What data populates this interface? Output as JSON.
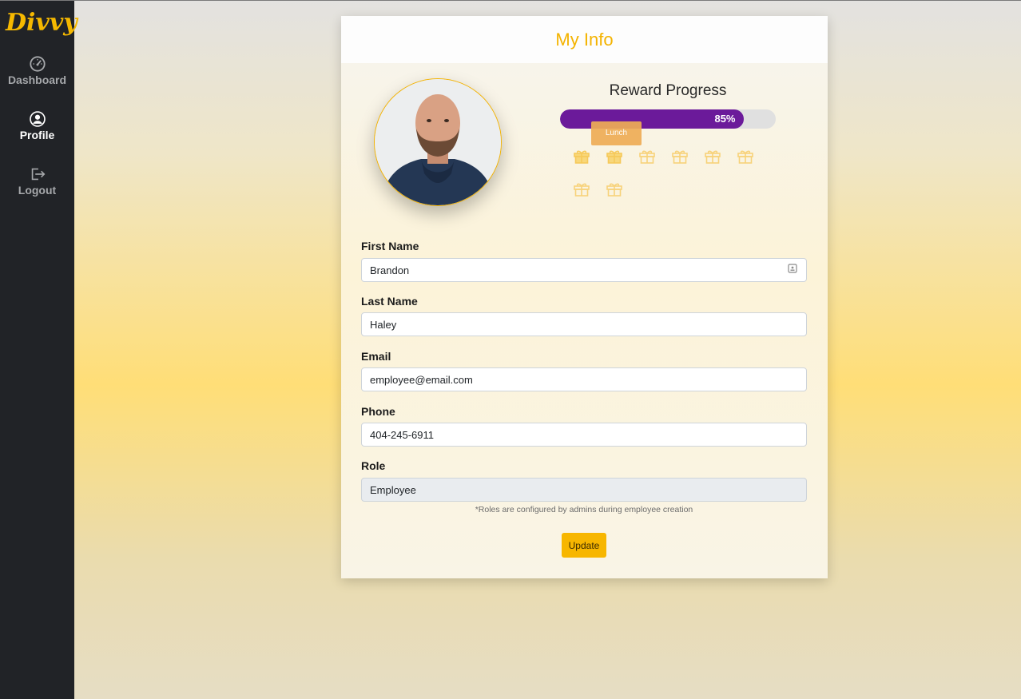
{
  "app": {
    "logo_text": "Divvy",
    "brand_color": "#f4b300"
  },
  "sidebar": {
    "items": [
      {
        "label": "Dashboard",
        "icon": "dashboard-gauge-icon",
        "active": false
      },
      {
        "label": "Profile",
        "icon": "user-circle-icon",
        "active": true
      },
      {
        "label": "Logout",
        "icon": "logout-icon",
        "active": false
      }
    ]
  },
  "card": {
    "title": "My Info",
    "avatar": {
      "icon": "avatar-photo"
    },
    "reward": {
      "title": "Reward Progress",
      "progress": 0.85,
      "progress_label": "85%",
      "progress_color": "#6b1a9a",
      "tooltip": "Lunch",
      "gifts": [
        {
          "name": "gift-icon",
          "earned": true
        },
        {
          "name": "gift-icon",
          "earned": true
        },
        {
          "name": "gift-icon",
          "earned": false
        },
        {
          "name": "gift-icon",
          "earned": false
        },
        {
          "name": "gift-icon",
          "earned": false
        },
        {
          "name": "gift-icon",
          "earned": false
        },
        {
          "name": "gift-icon",
          "earned": false
        },
        {
          "name": "gift-icon",
          "earned": false
        }
      ]
    },
    "form": {
      "first_name": {
        "label": "First Name",
        "value": "Brandon"
      },
      "last_name": {
        "label": "Last Name",
        "value": "Haley"
      },
      "email": {
        "label": "Email",
        "value": "employee@email.com"
      },
      "phone": {
        "label": "Phone",
        "value": "404-245-6911"
      },
      "role": {
        "label": "Role",
        "value": "Employee"
      },
      "role_note": "*Roles are configured by admins during employee creation",
      "update_label": "Update"
    }
  }
}
